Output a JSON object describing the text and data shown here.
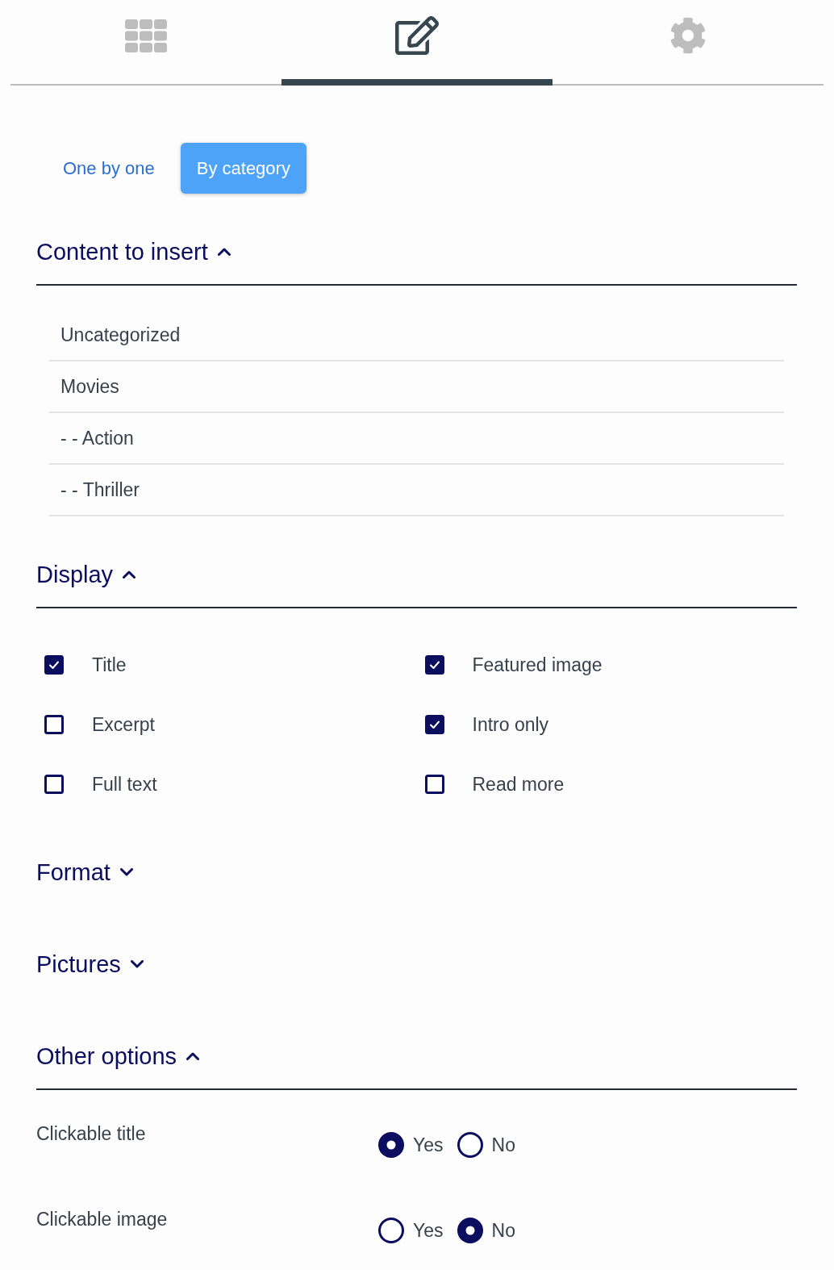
{
  "tabs": [
    {
      "kind": "grid",
      "selected": false
    },
    {
      "kind": "edit",
      "selected": true
    },
    {
      "kind": "settings",
      "selected": false
    }
  ],
  "modes": [
    {
      "label": "One by one",
      "selected": false
    },
    {
      "label": "By category",
      "selected": true
    }
  ],
  "sections": [
    {
      "title": "Content to insert",
      "expanded": true,
      "kind": "list",
      "items": [
        "Uncategorized",
        "Movies",
        "- - Action",
        "- - Thriller"
      ]
    },
    {
      "title": "Display",
      "expanded": true,
      "kind": "checkboxes",
      "options": [
        {
          "label": "Title",
          "checked": true
        },
        {
          "label": "Featured image",
          "checked": true
        },
        {
          "label": "Excerpt",
          "checked": false
        },
        {
          "label": "Intro only",
          "checked": true
        },
        {
          "label": "Full text",
          "checked": false
        },
        {
          "label": "Read more",
          "checked": false
        }
      ]
    },
    {
      "title": "Format",
      "expanded": false
    },
    {
      "title": "Pictures",
      "expanded": false
    },
    {
      "title": "Other options",
      "expanded": true,
      "kind": "radios",
      "rows": [
        {
          "label": "Clickable title",
          "choices": [
            {
              "label": "Yes",
              "selected": true
            },
            {
              "label": "No",
              "selected": false
            }
          ]
        },
        {
          "label": "Clickable image",
          "choices": [
            {
              "label": "Yes",
              "selected": false
            },
            {
              "label": "No",
              "selected": true
            }
          ]
        }
      ]
    }
  ]
}
